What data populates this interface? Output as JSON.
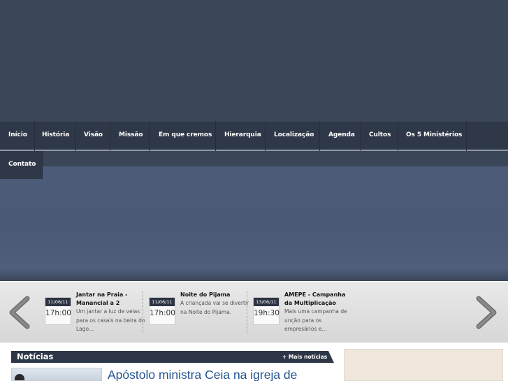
{
  "nav": {
    "items": [
      "Início",
      "História",
      "Visão",
      "Missão",
      "Em que cremos",
      "Hierarquia",
      "Localização",
      "Agenda",
      "Cultos",
      "Os 5 Ministérios"
    ],
    "row2": [
      "Contato"
    ]
  },
  "events": {
    "items": [
      {
        "date": "11/06/11",
        "time": "17h:00",
        "title": "Jantar na Praia - Manancial a 2",
        "desc": "Um jantar a luz de velas para os casais na beira do Lago..."
      },
      {
        "date": "11/06/11",
        "time": "17h:00",
        "title": "Noite do Pijama",
        "desc": "A criançada vai se divertir na Noite do Pijama."
      },
      {
        "date": "13/06/11",
        "time": "19h:30",
        "title": "AMEPE - Campanha da Multiplicação",
        "desc": "Mais uma campanha de unção para os empresários e..."
      }
    ]
  },
  "news": {
    "title": "Notícias",
    "more_link": "+ Mais notícias",
    "headline": "Apóstolo ministra Ceia na igreja de"
  },
  "colors": {
    "header": "#3b4659",
    "nav": "#2f3848",
    "banner": "#4b5b78",
    "link": "#23538f"
  }
}
